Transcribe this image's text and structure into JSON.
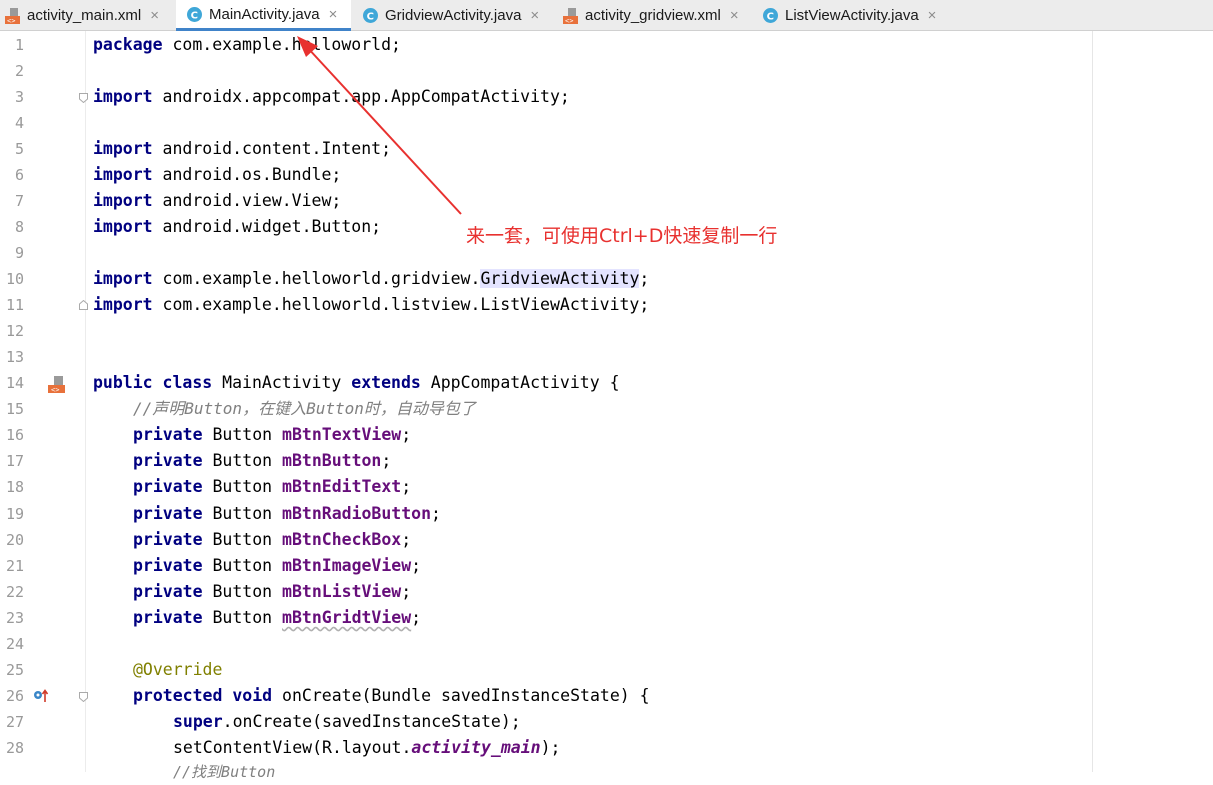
{
  "tabs": [
    {
      "label": "activity_main.xml",
      "icon": "xml-layout-icon",
      "active": false
    },
    {
      "label": "MainActivity.java",
      "icon": "java-class-icon",
      "active": true
    },
    {
      "label": "GridviewActivity.java",
      "icon": "java-class-icon",
      "active": false
    },
    {
      "label": "activity_gridview.xml",
      "icon": "xml-layout-icon",
      "active": false
    },
    {
      "label": "ListViewActivity.java",
      "icon": "java-class-icon",
      "active": false
    }
  ],
  "tab_close_glyph": "×",
  "line_numbers": [
    "1",
    "2",
    "3",
    "4",
    "5",
    "6",
    "7",
    "8",
    "9",
    "10",
    "11",
    "12",
    "13",
    "14",
    "15",
    "16",
    "17",
    "18",
    "19",
    "20",
    "21",
    "22",
    "23",
    "24",
    "25",
    "26",
    "27",
    "28"
  ],
  "code": {
    "l1_kw": "package",
    "l1_rest": " com.example.helloworld;",
    "l3_kw": "import",
    "l3_rest": " androidx.appcompat.app.AppCompatActivity;",
    "l5_kw": "import",
    "l5_rest": " android.content.Intent;",
    "l6_kw": "import",
    "l6_rest": " android.os.Bundle;",
    "l7_kw": "import",
    "l7_rest": " android.view.View;",
    "l8_kw": "import",
    "l8_rest": " android.widget.Button;",
    "l10_kw": "import",
    "l10_rest": " com.example.helloworld.gridview.",
    "l10_hl": "GridviewActivity",
    "l10_end": ";",
    "l11_kw": "import",
    "l11_rest": " com.example.helloworld.listview.ListViewActivity;",
    "l14_kw1": "public",
    "l14_kw2": "class",
    "l14_name": " MainActivity ",
    "l14_kw3": "extends",
    "l14_rest": " AppCompatActivity {",
    "l15_comment": "//声明Button，在键入Button时，自动导包了",
    "private_kw": "private",
    "button_type": " Button ",
    "fields": [
      "mBtnTextView",
      "mBtnButton",
      "mBtnEditText",
      "mBtnRadioButton",
      "mBtnCheckBox",
      "mBtnImageView",
      "mBtnListView",
      "mBtnGridtView"
    ],
    "semicolon": ";",
    "l25_annotation": "@Override",
    "l26_kw1": "protected",
    "l26_kw2": "void",
    "l26_rest": " onCreate(Bundle savedInstanceState) {",
    "l27_kw": "super",
    "l27_rest": ".onCreate(savedInstanceState);",
    "l28_start": "setContentView(R.layout.",
    "l28_ital": "activity_main",
    "l28_end": ");",
    "l29_comment": "//找到Button"
  },
  "annotation": {
    "text": "来一套，可使用Ctrl+D快速复制一行",
    "color": "#e8312f"
  }
}
